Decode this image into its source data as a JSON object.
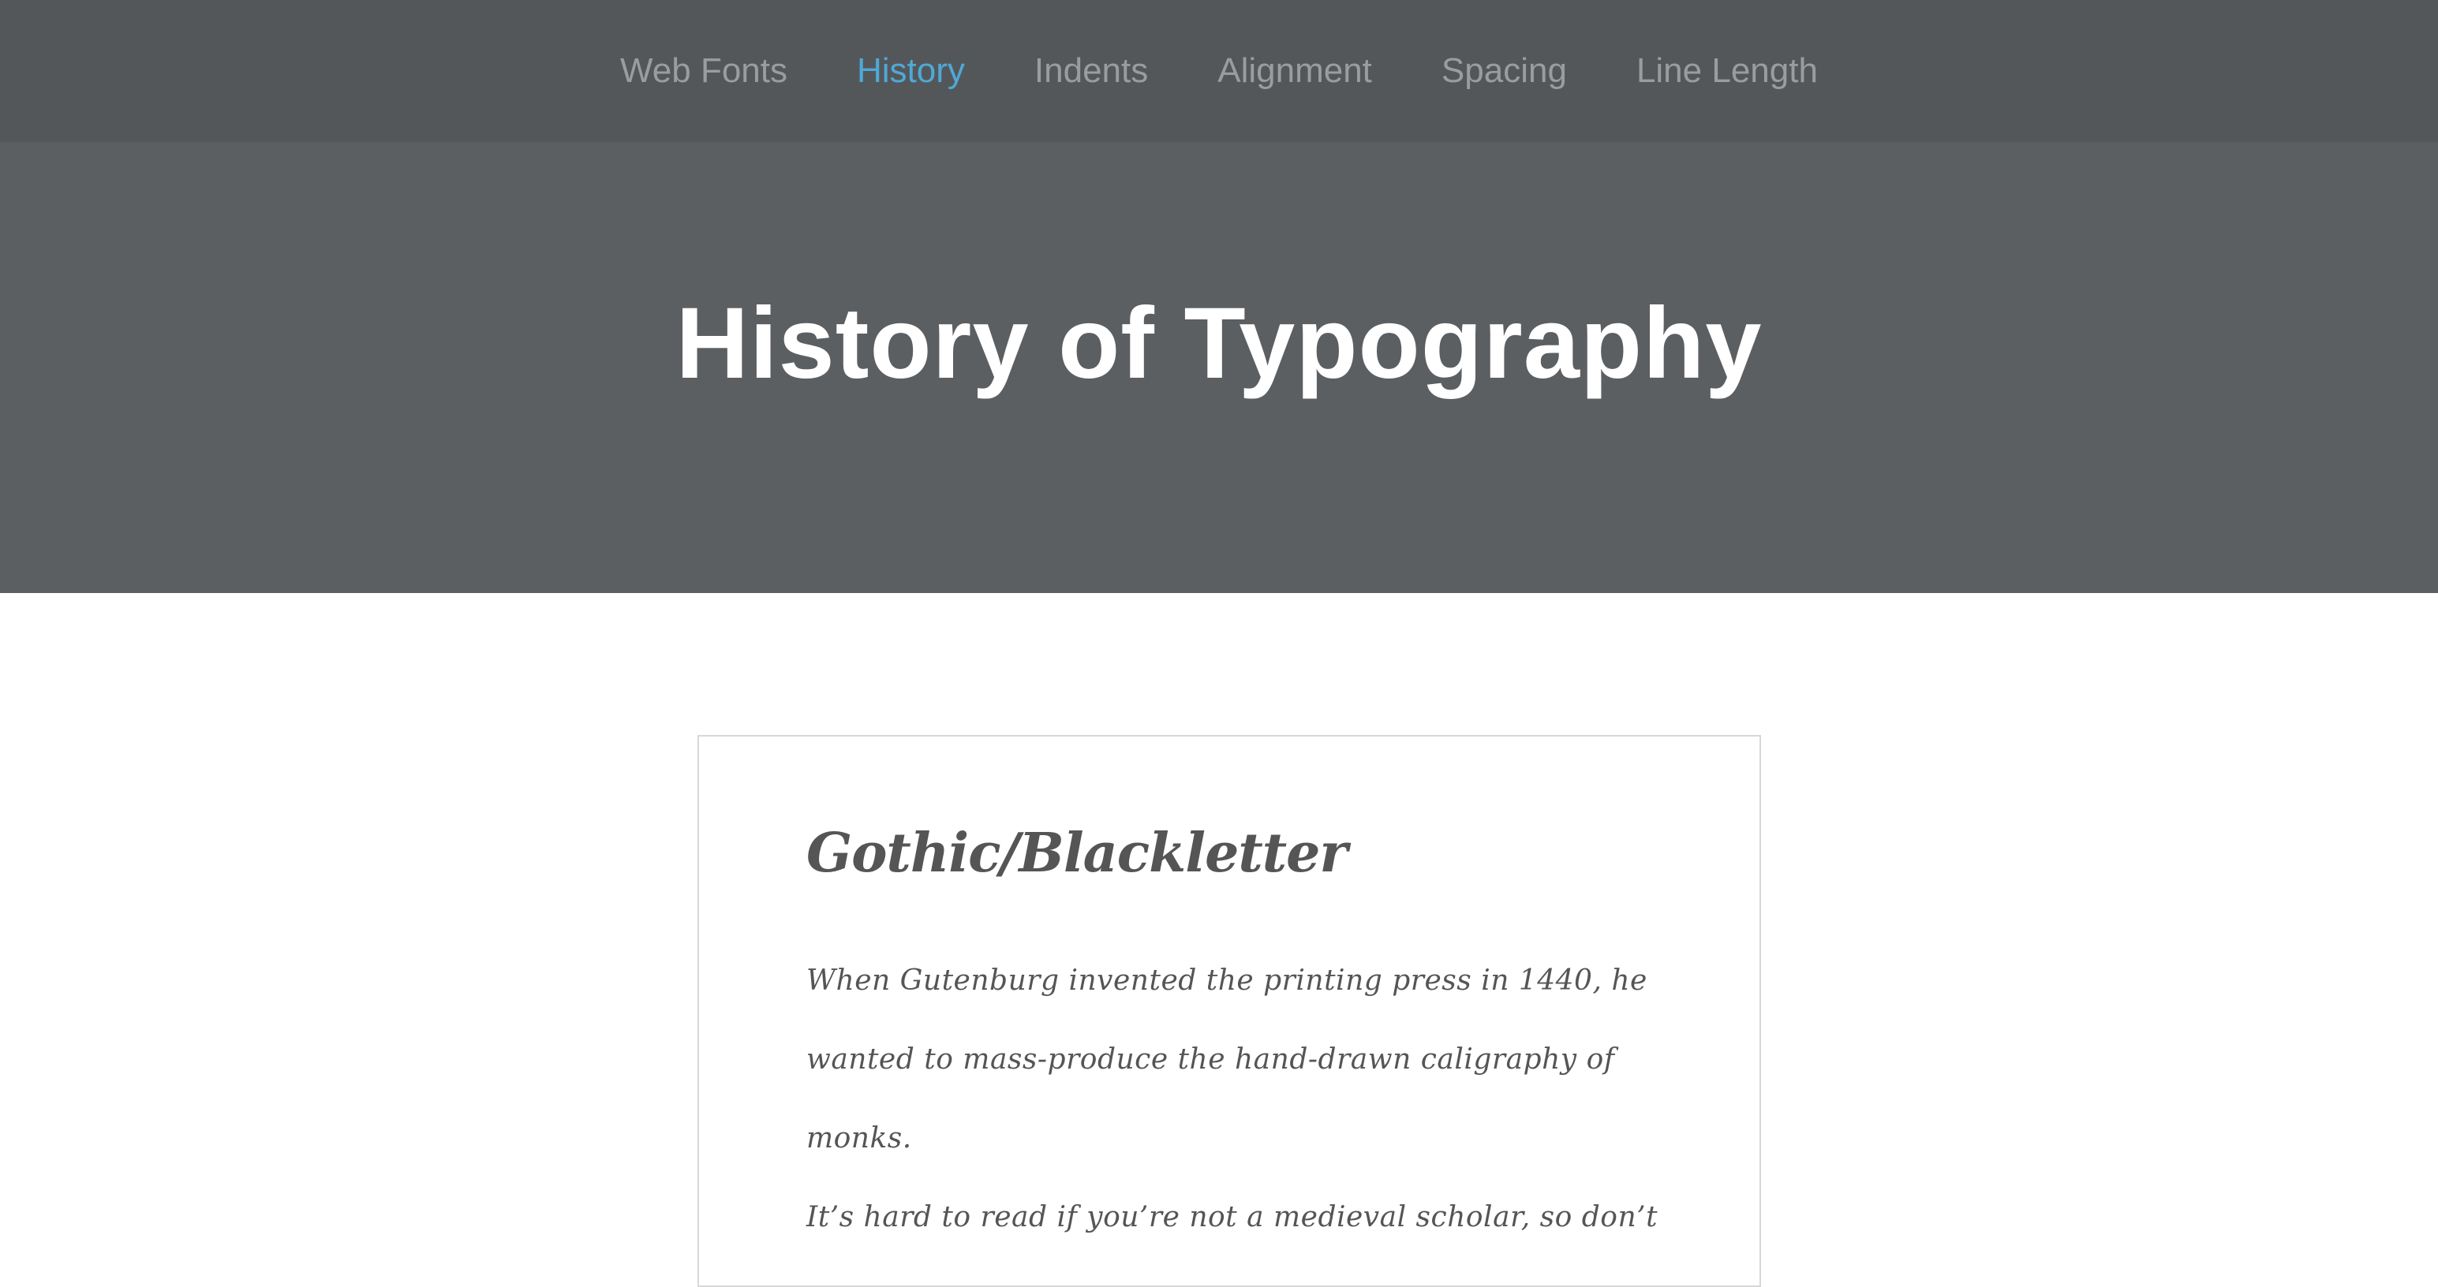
{
  "nav": {
    "items": [
      {
        "label": "Web Fonts"
      },
      {
        "label": "History"
      },
      {
        "label": "Indents"
      },
      {
        "label": "Alignment"
      },
      {
        "label": "Spacing"
      },
      {
        "label": "Line Length"
      }
    ],
    "active": "History"
  },
  "hero": {
    "title": "History of Typography"
  },
  "section": {
    "heading": "Gothic/Blackletter",
    "lines": [
      "When Gutenburg invented the printing press in 1440, he",
      "wanted to mass-produce the hand-drawn caligraphy of monks.",
      "It’s hard to read if you’re not a medieval scholar, so don’t"
    ]
  },
  "colors": {
    "nav_bg": "#54575a",
    "hero_bg": "#5c5f62",
    "nav_text": "#9a9da0",
    "nav_active": "#4ea9d6",
    "body_text": "#555555"
  }
}
